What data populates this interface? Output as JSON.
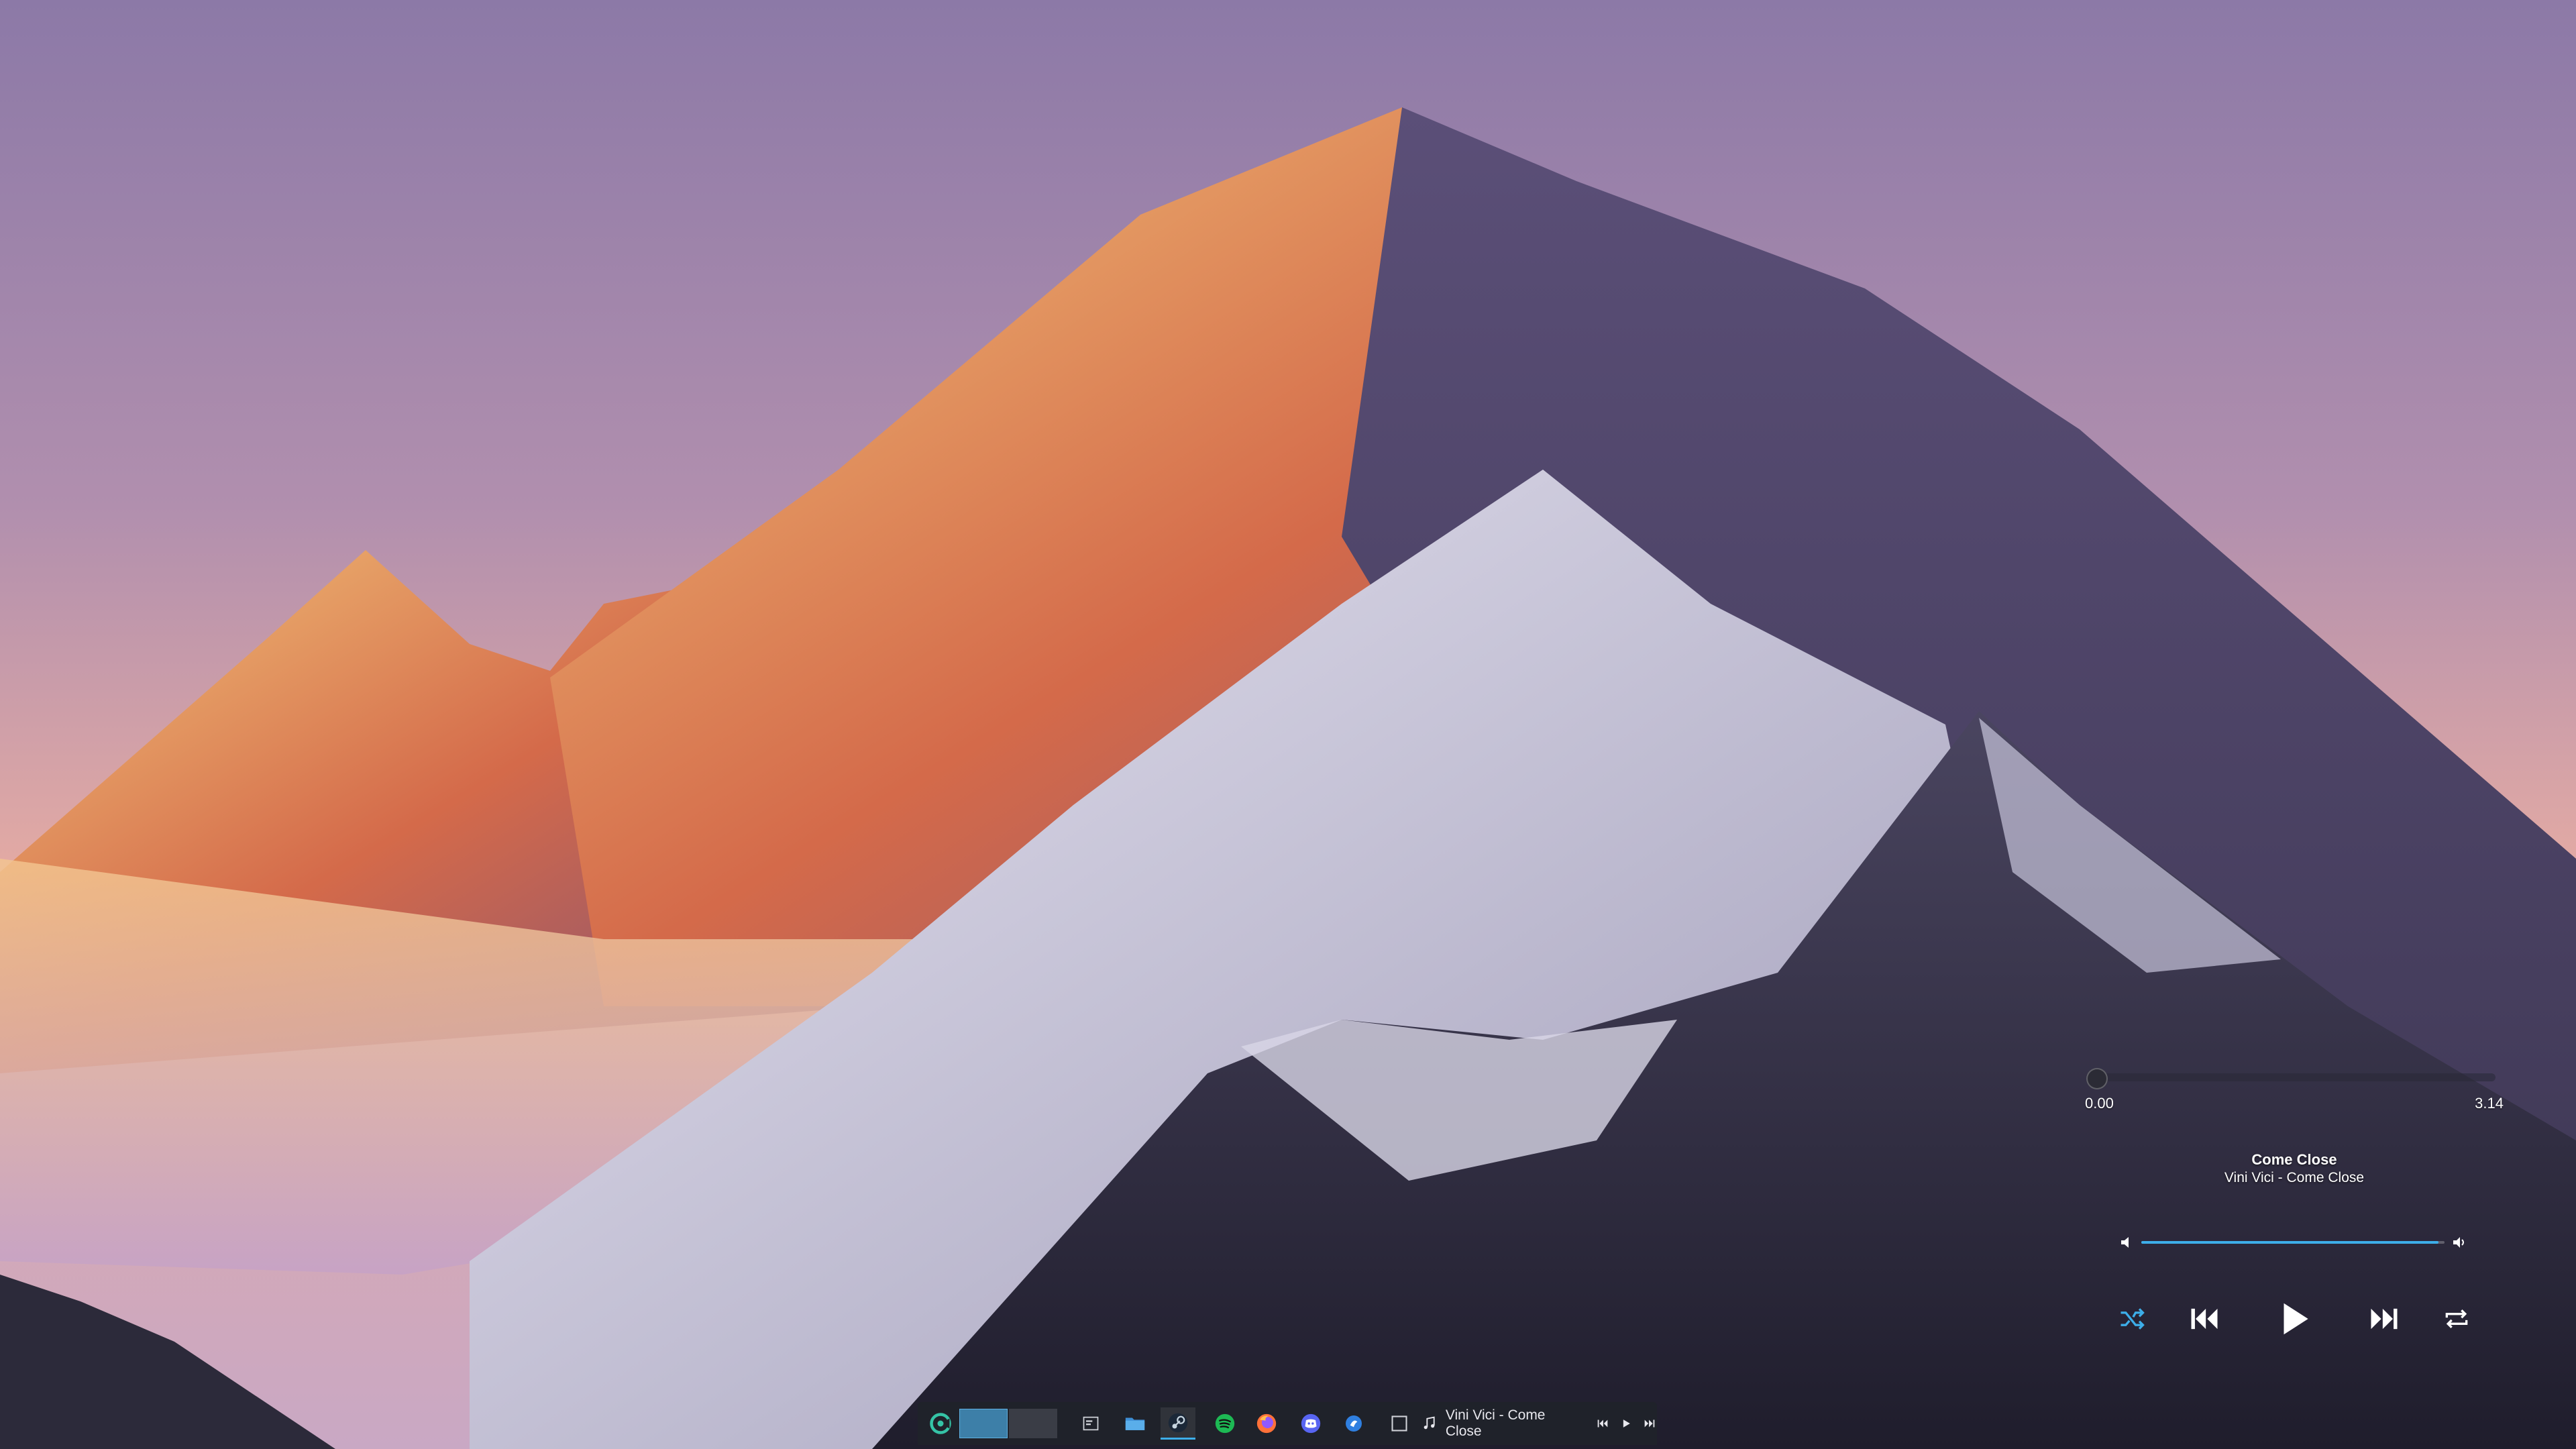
{
  "colors": {
    "accent": "#3daee9",
    "taskbar_bg": "#20232a",
    "sky_top": "#8e7aa6",
    "sky_bottom": "#e4aaa4"
  },
  "wallpaper": {
    "description_icon": "mountain-landscape"
  },
  "media_player": {
    "time_elapsed": "0.00",
    "time_total": "3.14",
    "progress_fraction": 0.0,
    "track_title": "Come Close",
    "track_subtitle": "Vini Vici - Come Close",
    "volume_fraction": 0.98,
    "controls": {
      "shuffle_icon": "shuffle-icon",
      "previous_icon": "skip-previous-icon",
      "play_icon": "play-icon",
      "next_icon": "skip-next-icon",
      "repeat_icon": "repeat-icon"
    }
  },
  "taskbar": {
    "launcher_icon": "app-launcher-icon",
    "pager": {
      "desktops": 2,
      "active": 1
    },
    "apps": [
      {
        "icon": "show-desktop-icon"
      },
      {
        "icon": "file-manager-icon"
      },
      {
        "icon": "steam-icon"
      },
      {
        "icon": "spotify-icon"
      },
      {
        "icon": "firefox-icon"
      },
      {
        "icon": "discord-icon"
      },
      {
        "icon": "app-icon"
      },
      {
        "icon": "window-icon"
      }
    ],
    "now_playing": {
      "icon": "music-note-icon",
      "text": "Vini Vici - Come Close"
    }
  }
}
